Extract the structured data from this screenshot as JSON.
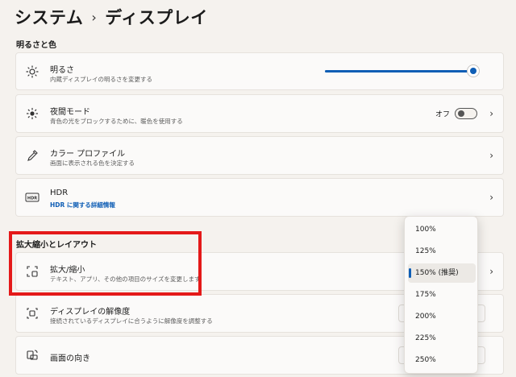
{
  "breadcrumb": {
    "parent": "システム",
    "separator": "›",
    "current": "ディスプレイ"
  },
  "sections": {
    "brightness_color": "明るさと色",
    "scale_layout": "拡大縮小とレイアウト"
  },
  "cards": {
    "brightness": {
      "title": "明るさ",
      "subtitle": "内蔵ディスプレイの明るさを変更する",
      "icon": "sun-icon",
      "value_percent": 100
    },
    "night_light": {
      "title": "夜間モード",
      "subtitle": "青色の光をブロックするために、暖色を使用する",
      "icon": "sun-small-icon",
      "toggle_label": "オフ",
      "toggle_on": false
    },
    "color_profile": {
      "title": "カラー プロファイル",
      "subtitle": "画面に表示される色を決定する",
      "icon": "eyedropper-icon"
    },
    "hdr": {
      "title": "HDR",
      "link": "HDR に関する詳細情報",
      "icon": "hdr-icon"
    },
    "scale": {
      "title": "拡大/縮小",
      "subtitle": "テキスト、アプリ、その他の項目のサイズを変更します",
      "icon": "scale-icon"
    },
    "resolution": {
      "title": "ディスプレイの解像度",
      "subtitle": "接続されているディスプレイに合うように解像度を調整する",
      "icon": "resolution-icon"
    },
    "orientation": {
      "title": "画面の向き",
      "icon": "orientation-icon"
    }
  },
  "scale_options": [
    "100%",
    "125%",
    "150% (推奨)",
    "175%",
    "200%",
    "225%",
    "250%"
  ],
  "selected_scale": "150% (推奨)",
  "colors": {
    "accent": "#0f5eb5",
    "highlight": "#e41919",
    "background": "#f5f2ee"
  }
}
